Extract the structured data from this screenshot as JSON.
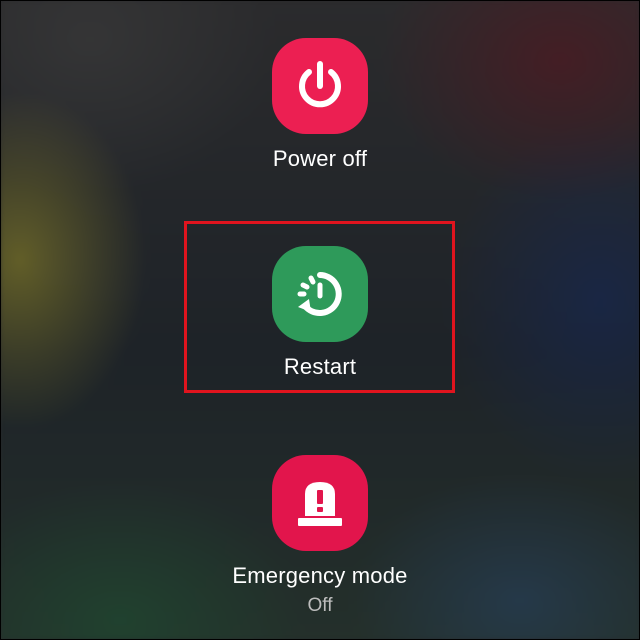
{
  "power_menu": {
    "options": [
      {
        "label": "Power off",
        "icon": "power-icon",
        "color": "#ec1f52"
      },
      {
        "label": "Restart",
        "icon": "restart-icon",
        "color": "#2e9a5a"
      },
      {
        "label": "Emergency mode",
        "sublabel": "Off",
        "icon": "emergency-beacon-icon",
        "color": "#e2154c"
      }
    ],
    "highlight_color": "#e0141e"
  }
}
